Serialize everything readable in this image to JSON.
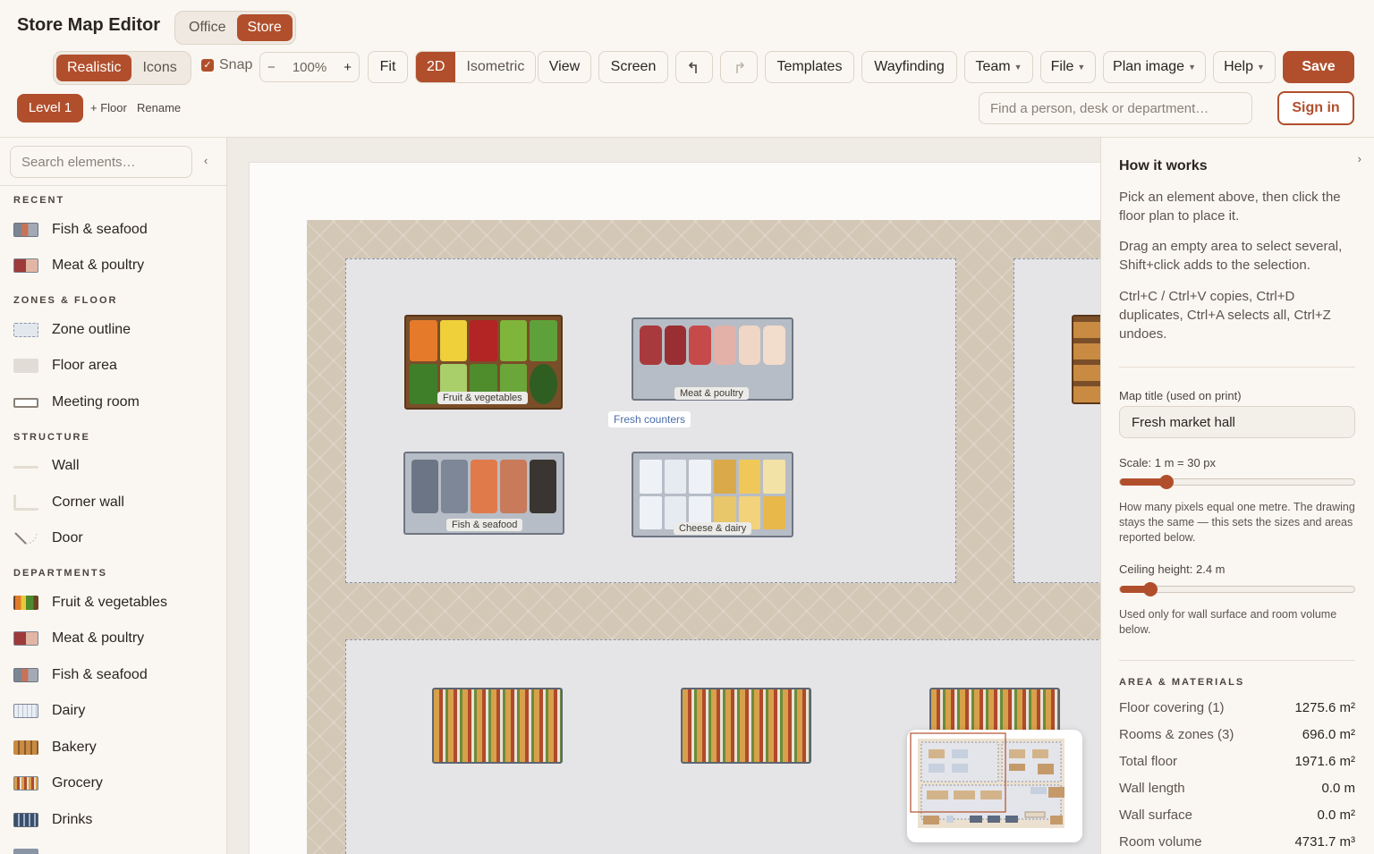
{
  "app": {
    "title": "Store Map Editor",
    "mode_tabs": [
      "Office",
      "Store"
    ],
    "active_mode": "Store"
  },
  "toolbar": {
    "style_tabs": [
      "Realistic",
      "Icons"
    ],
    "active_style": "Realistic",
    "snap_label": "Snap",
    "snap_checked": true,
    "zoom_minus": "−",
    "zoom_value": "100%",
    "zoom_plus": "+",
    "fit": "Fit",
    "view_tabs": [
      "2D",
      "Isometric"
    ],
    "active_view": "2D",
    "view": "View",
    "screen": "Screen",
    "undo_icon": "undo-icon",
    "redo_icon": "redo-icon",
    "templates": "Templates",
    "wayfinding": "Wayfinding",
    "team": "Team",
    "file": "File",
    "plan_image": "Plan image",
    "help": "Help",
    "save": "Save"
  },
  "levels": {
    "active": "Level 1",
    "add_floor": "+ Floor",
    "rename": "Rename"
  },
  "search": {
    "placeholder": "Find a person, desk or department…"
  },
  "auth": {
    "sign_in": "Sign in"
  },
  "sidebar": {
    "search_placeholder": "Search elements…",
    "collapse_icon": "chevron-left-icon",
    "sections": [
      {
        "title": "RECENT",
        "items": [
          "Fish & seafood",
          "Meat & poultry"
        ]
      },
      {
        "title": "ZONES & FLOOR",
        "items": [
          "Zone outline",
          "Floor area",
          "Meeting room"
        ]
      },
      {
        "title": "STRUCTURE",
        "items": [
          "Wall",
          "Corner wall",
          "Door"
        ]
      },
      {
        "title": "DEPARTMENTS",
        "items": [
          "Fruit & vegetables",
          "Meat & poultry",
          "Fish & seafood",
          "Dairy",
          "Bakery",
          "Grocery",
          "Drinks"
        ]
      }
    ]
  },
  "canvas": {
    "zone_label": "Fresh counters",
    "fixtures": [
      "Fruit & vegetables",
      "Meat & poultry",
      "Fish & seafood",
      "Cheese & dairy"
    ],
    "colors": {
      "floor": "#d3c7b6",
      "zone": "#e5e5e7",
      "zone_border": "#8a95a6",
      "accent": "#b14f2c"
    }
  },
  "panel": {
    "close_icon": "chevron-right-icon",
    "how_title": "How it works",
    "how_texts": [
      "Pick an element above, then click the floor plan to place it.",
      "Drag an empty area to select several, Shift+click adds to the selection.",
      "Ctrl+C / Ctrl+V copies, Ctrl+D duplicates, Ctrl+A selects all, Ctrl+Z undoes."
    ],
    "map_title_label": "Map title (used on print)",
    "map_title_value": "Fresh market hall",
    "scale_label": "Scale: 1 m = 30 px",
    "scale_fraction": 0.2,
    "scale_help": "How many pixels equal one metre. The drawing stays the same — this sets the sizes and areas reported below.",
    "ceiling_label": "Ceiling height: 2.4 m",
    "ceiling_fraction": 0.13,
    "ceiling_help": "Used only for wall surface and room volume below.",
    "area_title": "AREA & MATERIALS",
    "rows": [
      {
        "k": "Floor covering (1)",
        "v": "1275.6 m²"
      },
      {
        "k": "Rooms & zones (3)",
        "v": "696.0 m²"
      },
      {
        "k": "Total floor",
        "v": "1971.6 m²"
      },
      {
        "k": "Wall length",
        "v": "0.0 m"
      },
      {
        "k": "Wall surface",
        "v": "0.0 m²"
      },
      {
        "k": "Room volume",
        "v": "4731.7 m³"
      }
    ]
  }
}
